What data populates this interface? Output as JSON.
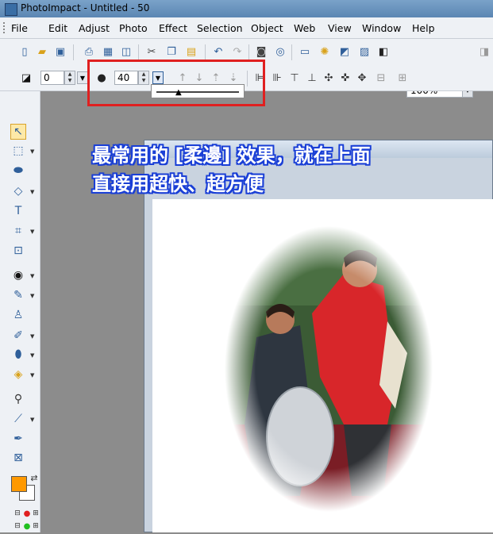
{
  "window": {
    "title": "PhotoImpact - Untitled - 50"
  },
  "menu": [
    "File",
    "Edit",
    "Adjust",
    "Photo",
    "Effect",
    "Selection",
    "Object",
    "Web",
    "View",
    "Window",
    "Help"
  ],
  "toolbar": {
    "zoom": "100%"
  },
  "attributes": {
    "width_value": "0",
    "softedge_value": "40"
  },
  "document": {
    "title": "Untitled - 50"
  },
  "overlay_text": {
    "line1": "最常用的 [柔邊] 效果，就在上面",
    "line2": "直接用超快、超方便"
  },
  "colors": {
    "foreground": "#ff9900",
    "background": "#ffffff",
    "highlight_box": "#e02020",
    "overlay_outline": "#1a3fd6"
  },
  "icons": [
    "new-icon",
    "open-icon",
    "save-icon",
    "print-icon",
    "cut-icon",
    "copy-icon",
    "paste-icon",
    "undo-icon",
    "redo-icon",
    "camera-icon",
    "zoom-icon",
    "pick-tool-icon",
    "text-tool-icon",
    "eyedropper-icon"
  ]
}
